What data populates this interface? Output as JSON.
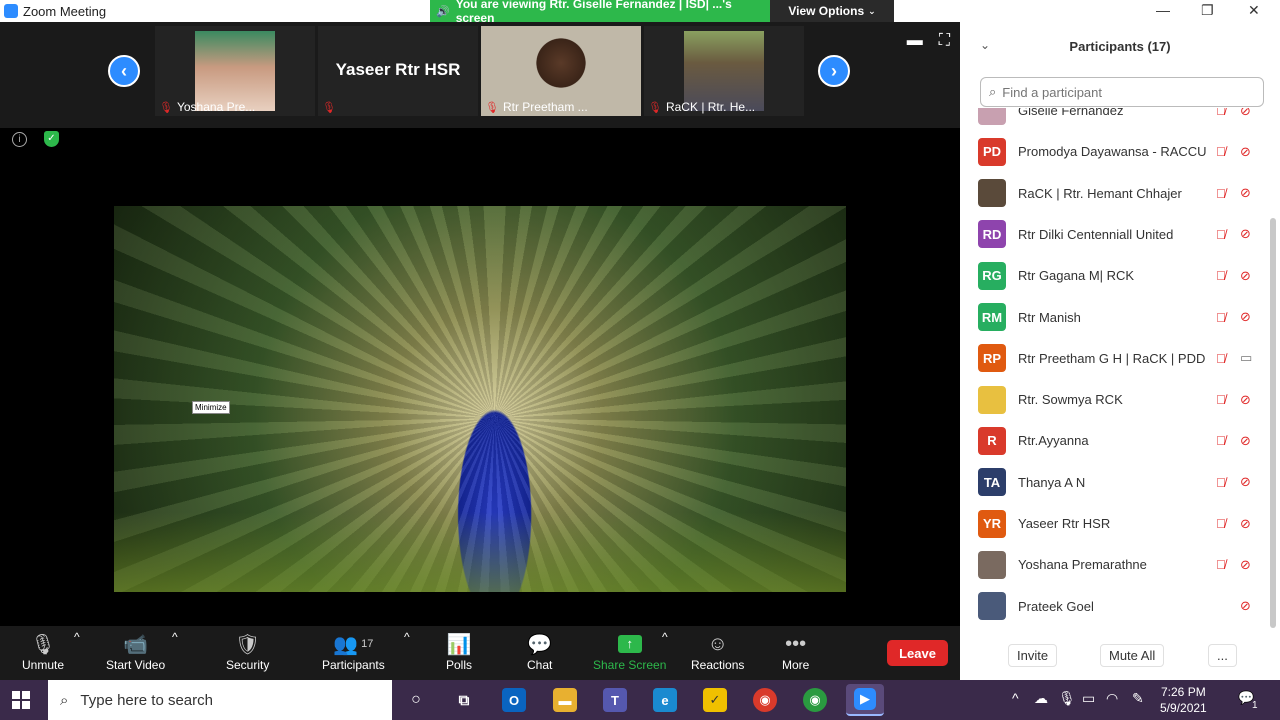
{
  "window": {
    "title": "Zoom Meeting",
    "minimize": "—",
    "maximize": "❐",
    "close": "✕"
  },
  "banner": {
    "text": "You are viewing Rtr. Giselle Fernandez | ISD| ...'s screen",
    "view_options": "View Options"
  },
  "strip": {
    "tiles": [
      {
        "name": "Yoshana Pre..."
      },
      {
        "name": "",
        "big": "Yaseer Rtr HSR"
      },
      {
        "name": "Rtr Preetham ..."
      },
      {
        "name": "RaCK | Rtr. He..."
      }
    ]
  },
  "share": {
    "tooltip": "Minimize"
  },
  "toolbar": {
    "unmute": "Unmute",
    "start_video": "Start Video",
    "security": "Security",
    "participants": "Participants",
    "participants_count": "17",
    "polls": "Polls",
    "chat": "Chat",
    "share_screen": "Share Screen",
    "reactions": "Reactions",
    "more": "More",
    "leave": "Leave"
  },
  "panel": {
    "title": "Participants (17)",
    "search_placeholder": "Find a participant",
    "participants": [
      {
        "name": "Giselle Fernandez",
        "initials": "",
        "color": "#c8a0b0",
        "cam": "off"
      },
      {
        "name": "Promodya Dayawansa - RACCU",
        "initials": "PD",
        "color": "#d93a2b",
        "cam": "off"
      },
      {
        "name": "RaCK | Rtr. Hemant Chhajer",
        "initials": "",
        "color": "#5a4a3a",
        "cam": "off"
      },
      {
        "name": "Rtr Dilki Centenniall United",
        "initials": "RD",
        "color": "#8e44ad",
        "cam": "off"
      },
      {
        "name": "Rtr Gagana M| RCK",
        "initials": "RG",
        "color": "#27ae60",
        "cam": "off"
      },
      {
        "name": "Rtr Manish",
        "initials": "RM",
        "color": "#27ae60",
        "cam": "off"
      },
      {
        "name": "Rtr Preetham G H | RaCK | PDD",
        "initials": "RP",
        "color": "#e05a10",
        "cam": "on"
      },
      {
        "name": "Rtr. Sowmya RCK",
        "initials": "",
        "color": "#e8c040",
        "cam": "off"
      },
      {
        "name": "Rtr.Ayyanna",
        "initials": "R",
        "color": "#d93a2b",
        "cam": "off"
      },
      {
        "name": "Thanya A N",
        "initials": "TA",
        "color": "#2c3e6a",
        "cam": "off"
      },
      {
        "name": "Yaseer Rtr HSR",
        "initials": "YR",
        "color": "#e05a10",
        "cam": "off"
      },
      {
        "name": "Yoshana Premarathne",
        "initials": "",
        "color": "#7a6a60",
        "cam": "off"
      },
      {
        "name": "Prateek Goel",
        "initials": "",
        "color": "#4a5a7a",
        "cam": "off",
        "nomic": true
      }
    ],
    "invite": "Invite",
    "mute_all": "Mute All",
    "more": "..."
  },
  "taskbar": {
    "search_placeholder": "Type here to search",
    "time": "7:26 PM",
    "date": "5/9/2021",
    "notif": "1"
  }
}
